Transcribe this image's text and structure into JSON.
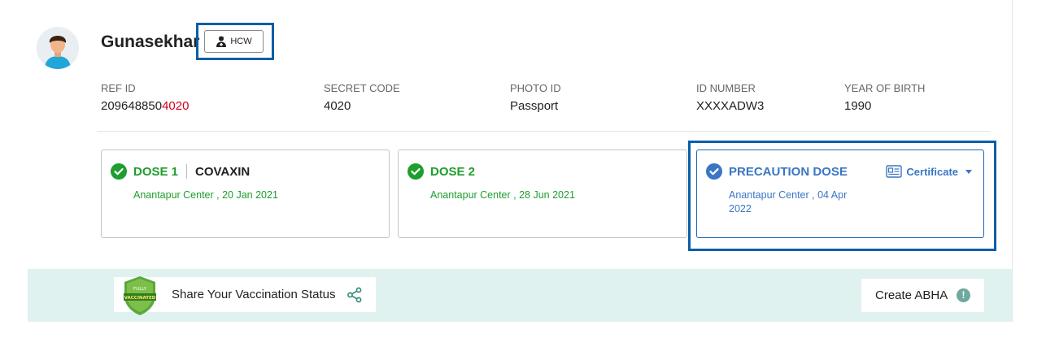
{
  "profile": {
    "name": "Gunasekhar",
    "badge": "HCW"
  },
  "info": [
    {
      "label": "REF ID",
      "value_prefix": "209648850",
      "value_suffix": "4020"
    },
    {
      "label": "SECRET CODE",
      "value": "4020"
    },
    {
      "label": "PHOTO ID",
      "value": "Passport"
    },
    {
      "label": "ID NUMBER",
      "value": "XXXXADW3"
    },
    {
      "label": "YEAR OF BIRTH",
      "value": "1990"
    }
  ],
  "doses": [
    {
      "title": "DOSE 1",
      "vaccine": "COVAXIN",
      "detail": "Anantapur Center , 20 Jan 2021"
    },
    {
      "title": "DOSE 2",
      "detail": "Anantapur Center , 28 Jun 2021"
    },
    {
      "title": "PRECAUTION DOSE",
      "detail": "Anantapur Center , 04 Apr 2022",
      "action": "Certificate"
    }
  ],
  "footer": {
    "share_label": "Share Your Vaccination Status",
    "shield_text_top": "FULLY",
    "shield_text_bottom": "VACCINATED",
    "abha_label": "Create ABHA",
    "abha_info": "!"
  },
  "colors": {
    "green": "#1e9e2e",
    "blue": "#3a76c4",
    "highlight": "#0a5ea8",
    "footer_bg": "#dff2ef",
    "ref_suffix": "#d0021b"
  }
}
